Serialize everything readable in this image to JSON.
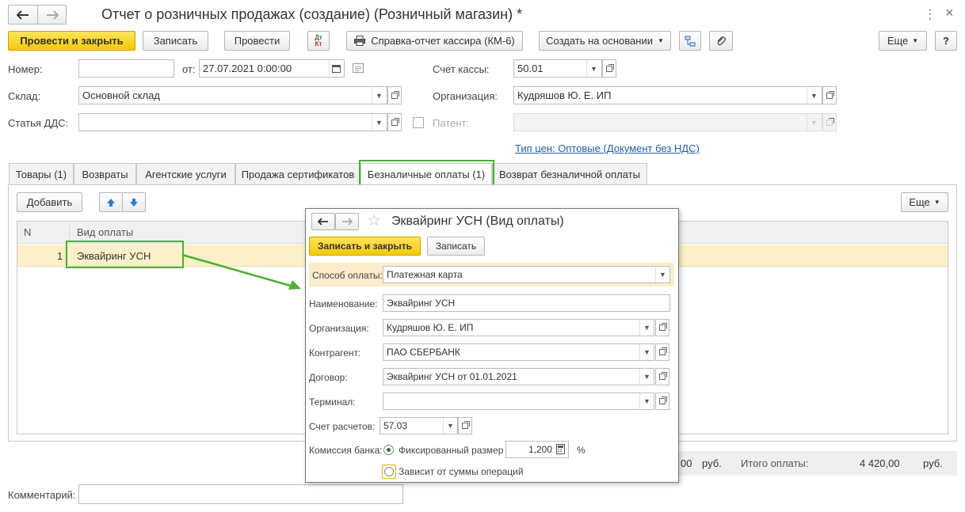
{
  "window": {
    "title": "Отчет о розничных продажах (создание) (Розничный магазин) *",
    "menu_icon": "more-vertical-icon",
    "close_icon": "close-icon"
  },
  "toolbar": {
    "post_close": "Провести и закрыть",
    "save": "Записать",
    "post": "Провести",
    "dt_kt": "ДтКт",
    "cashier_report": "Справка-отчет кассира (КМ-6)",
    "create_based": "Создать на основании",
    "more": "Еще",
    "help": "?"
  },
  "form": {
    "number_label": "Номер:",
    "number_value": "",
    "from_label": "от:",
    "date_value": "27.07.2021  0:00:00",
    "cash_account_label": "Счет кассы:",
    "cash_account_value": "50.01",
    "warehouse_label": "Склад:",
    "warehouse_value": "Основной склад",
    "organization_label": "Организация:",
    "organization_value": "Кудряшов Ю. Е. ИП",
    "dds_label": "Статья ДДС:",
    "dds_value": "",
    "patent_label": "Патент:",
    "patent_value": "",
    "price_type_link": "Тип цен: Оптовые (Документ без НДС)",
    "comment_label": "Комментарий:",
    "comment_value": ""
  },
  "tabs": [
    {
      "label": "Товары (1)"
    },
    {
      "label": "Возвраты"
    },
    {
      "label": "Агентские услуги"
    },
    {
      "label": "Продажа сертификатов"
    },
    {
      "label": "Безналичные оплаты (1)"
    },
    {
      "label": "Возврат безналичной оплаты"
    }
  ],
  "table": {
    "add_button": "Добавить",
    "more": "Еще",
    "col_n": "N",
    "col_type": "Вид оплаты",
    "rows": [
      {
        "n": "1",
        "type": "Эквайринг УСН"
      }
    ]
  },
  "totals": {
    "partial_amount": "00",
    "currency1": "руб.",
    "total_label": "Итого оплаты:",
    "total_value": "4 420,00",
    "currency2": "руб."
  },
  "popup": {
    "title": "Эквайринг УСН (Вид оплаты)",
    "save_close": "Записать и закрыть",
    "save": "Записать",
    "method_label": "Способ оплаты:",
    "method_value": "Платежная карта",
    "name_label": "Наименование:",
    "name_value": "Эквайринг УСН",
    "org_label": "Организация:",
    "org_value": "Кудряшов Ю. Е. ИП",
    "counterparty_label": "Контрагент:",
    "counterparty_value": "ПАО СБЕРБАНК",
    "contract_label": "Договор:",
    "contract_value": "Эквайринг УСН от 01.01.2021",
    "terminal_label": "Терминал:",
    "terminal_value": "",
    "settle_label": "Счет расчетов:",
    "settle_value": "57.03",
    "commission_label": "Комиссия банка:",
    "fixed_label": "Фиксированный размер",
    "fixed_value": "1,200",
    "percent": "%",
    "depends_label": "Зависит от суммы операций"
  },
  "colors": {
    "accent_yellow": "#f4c90a",
    "highlight_green": "#4caf32",
    "selected_row": "#fbf0c8",
    "link_blue": "#1f5fa8"
  }
}
